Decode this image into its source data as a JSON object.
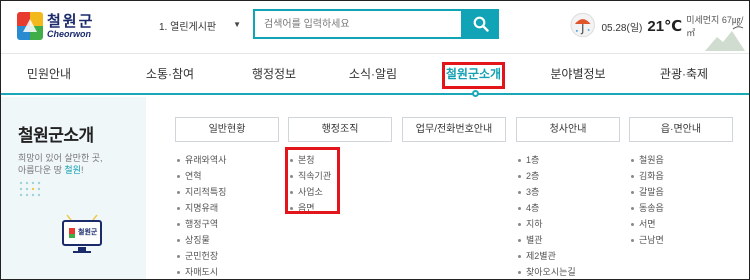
{
  "header": {
    "logo": {
      "korean": "철원군",
      "english": "Cheorwon"
    },
    "menu_select": {
      "value": "1. 열린게시판"
    },
    "search": {
      "placeholder": "검색어를 입력하세요"
    },
    "weather": {
      "date": "05.28(일)",
      "temp": "21℃",
      "dust": "미세먼지 67㎍/㎥"
    }
  },
  "nav": {
    "items": [
      {
        "label": "민원안내"
      },
      {
        "label": "소통·참여"
      },
      {
        "label": "행정정보"
      },
      {
        "label": "소식·알림"
      },
      {
        "label": "철원군소개"
      },
      {
        "label": "분야별정보"
      },
      {
        "label": "관광·축제"
      }
    ]
  },
  "panel": {
    "title": "철원군소개",
    "subtitle_line1": "희망이 있어 살만한 곳,",
    "subtitle_line2_prefix": "아름다운 땅 ",
    "subtitle_line2_highlight": "철원",
    "subtitle_line2_suffix": "!",
    "monitor_logo": "철원군",
    "columns": [
      {
        "header": "일반현황",
        "items": [
          "유래와역사",
          "연혁",
          "지리적특징",
          "지명유래",
          "행정구역",
          "상징물",
          "군민헌장",
          "자매도시"
        ]
      },
      {
        "header": "행정조직",
        "items": [
          "본청",
          "직속기관",
          "사업소",
          "읍면"
        ]
      },
      {
        "header": "업무/전화번호안내",
        "items": []
      },
      {
        "header": "청사안내",
        "items": [
          "1층",
          "2층",
          "3층",
          "4층",
          "지하",
          "별관",
          "제2별관",
          "찾아오시는길"
        ]
      },
      {
        "header": "읍·면안내",
        "items": [
          "철원읍",
          "김화읍",
          "갈말읍",
          "동송읍",
          "서면",
          "근남면"
        ]
      }
    ]
  },
  "colors": {
    "accent": "#11a3b6",
    "highlight_red": "#e4141b",
    "brand_navy": "#1b2a6b"
  }
}
